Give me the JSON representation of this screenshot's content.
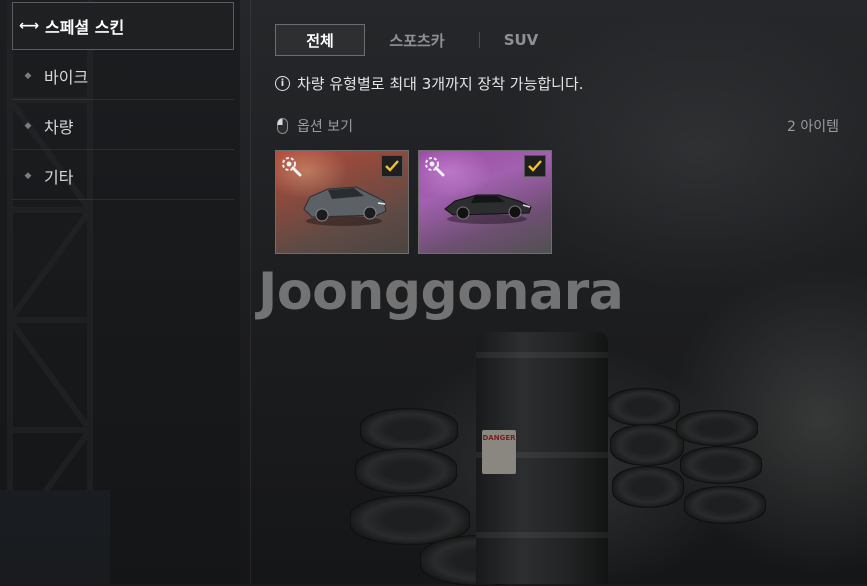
{
  "sidebar": {
    "items": [
      {
        "label": "스페셜 스킨",
        "active": true
      },
      {
        "label": "바이크",
        "active": false
      },
      {
        "label": "차량",
        "active": false
      },
      {
        "label": "기타",
        "active": false
      }
    ]
  },
  "tabs": [
    {
      "label": "전체",
      "active": true
    },
    {
      "label": "스포츠카",
      "active": false
    },
    {
      "label": "SUV",
      "active": false
    }
  ],
  "notice": {
    "icon": "info-icon",
    "text": "차량 유형별로 최대 3개까지 장착 가능합니다."
  },
  "options": {
    "icon": "mouse-icon",
    "label": "옵션 보기"
  },
  "item_count": "2 아이템",
  "items": [
    {
      "name": "suv-skin",
      "equipped": true,
      "icon": "car-icon",
      "background": "#b34a3a"
    },
    {
      "name": "sportscar-skin",
      "equipped": true,
      "icon": "car-icon",
      "background": "#a260b0"
    }
  ],
  "watermark": "Joonggonara",
  "barrel_label": "DANGER",
  "colors": {
    "check": "#f2c230",
    "active_border": "#6b6d70"
  }
}
